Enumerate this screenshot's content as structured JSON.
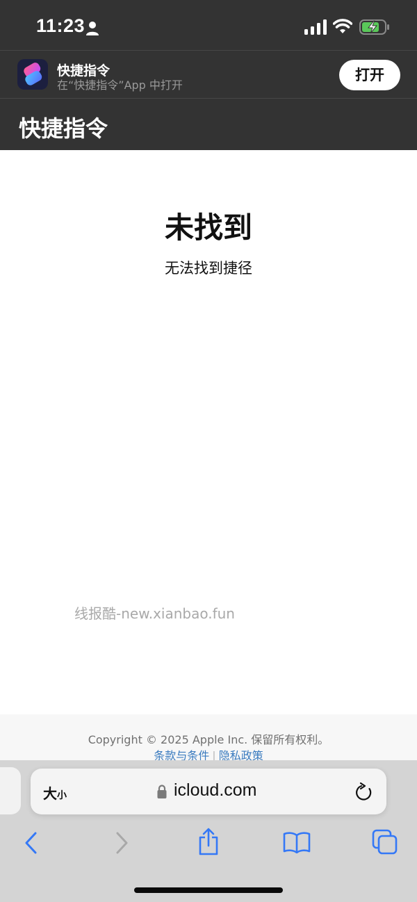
{
  "status_bar": {
    "time": "11:23",
    "icons": [
      "person-icon",
      "cellular-signal-icon",
      "wifi-icon",
      "battery-charging-icon"
    ]
  },
  "app_banner": {
    "app_name": "快捷指令",
    "subtitle": "在“快捷指令”App 中打开",
    "open_label": "打开",
    "icon": "shortcuts-app-icon"
  },
  "page_header": {
    "title": "快捷指令"
  },
  "main": {
    "title": "未找到",
    "message": "无法找到捷径",
    "watermark": "线报酷-new.xianbao.fun"
  },
  "footer": {
    "copyright": "Copyright © 2025 Apple Inc. 保留所有权利。",
    "links": [
      {
        "label": "条款与条件"
      },
      {
        "label": "隐私政策"
      }
    ],
    "separator": "|"
  },
  "safari": {
    "text_size_big": "大",
    "text_size_small": "小",
    "url": "icloud.com",
    "toolbar": [
      "back-icon",
      "forward-icon",
      "share-icon",
      "bookmarks-icon",
      "tabs-icon"
    ]
  },
  "colors": {
    "header_bg": "#333333",
    "link": "#3a7bbf",
    "toolbar_accent": "#3478f6"
  }
}
